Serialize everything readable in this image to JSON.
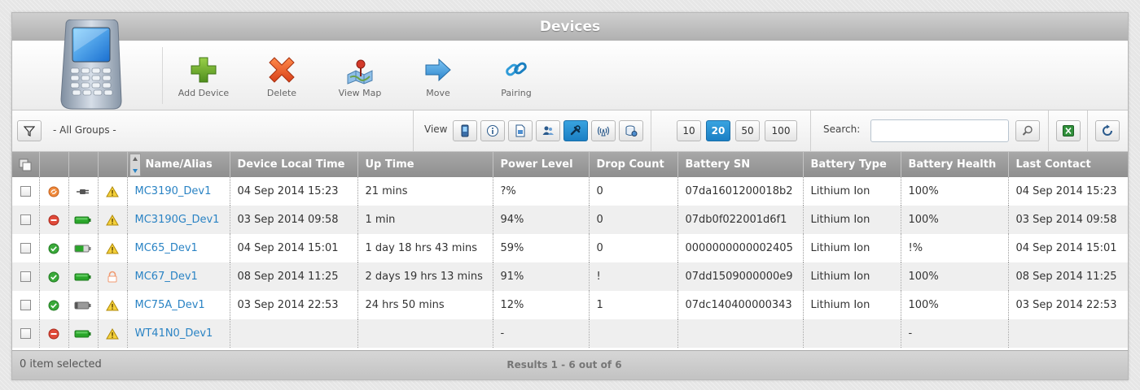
{
  "window": {
    "title": "Devices"
  },
  "toolbar": {
    "buttons": [
      {
        "label": "Add Device",
        "icon": "plus-icon"
      },
      {
        "label": "Delete",
        "icon": "x-icon"
      },
      {
        "label": "View Map",
        "icon": "map-icon"
      },
      {
        "label": "Move",
        "icon": "arrow-right-icon"
      },
      {
        "label": "Pairing",
        "icon": "link-icon"
      }
    ]
  },
  "filter": {
    "group_label": "- All Groups -",
    "view_label": "View",
    "page_sizes": [
      "10",
      "20",
      "50",
      "100"
    ],
    "active_page_size": "20",
    "search_label": "Search:",
    "search_value": ""
  },
  "grid": {
    "columns": [
      "Name/Alias",
      "Device Local Time",
      "Up Time",
      "Power Level",
      "Drop Count",
      "Battery SN",
      "Battery Type",
      "Battery Health",
      "Last Contact"
    ],
    "rows": [
      {
        "status": "sync",
        "power": "plug",
        "alert": "warning",
        "name": "MC3190_Dev1",
        "local_time": "04 Sep 2014 15:23",
        "uptime": "21 mins",
        "power_level": "?%",
        "drop_count": "0",
        "battery_sn": "07da1601200018b2",
        "battery_type": "Lithium Ion",
        "battery_health": "100%",
        "last_contact": "04 Sep 2014 15:23"
      },
      {
        "status": "disconnected",
        "power": "battery-full",
        "alert": "warning",
        "name": "MC3190G_Dev1",
        "local_time": "03 Sep 2014 09:58",
        "uptime": "1 min",
        "power_level": "94%",
        "drop_count": "0",
        "battery_sn": "07db0f022001d6f1",
        "battery_type": "Lithium Ion",
        "battery_health": "100%",
        "last_contact": "03 Sep 2014 09:58"
      },
      {
        "status": "ok",
        "power": "battery-half",
        "alert": "warning",
        "name": "MC65_Dev1",
        "local_time": "04 Sep 2014 15:01",
        "uptime": "1 day 18 hrs 43 mins",
        "power_level": "59%",
        "drop_count": "0",
        "battery_sn": "0000000000002405",
        "battery_type": "Lithium Ion",
        "battery_health": "!%",
        "last_contact": "04 Sep 2014 15:01"
      },
      {
        "status": "ok",
        "power": "battery-full",
        "alert": "lock",
        "name": "MC67_Dev1",
        "local_time": "08 Sep 2014 11:25",
        "uptime": "2 days 19 hrs 13 mins",
        "power_level": "91%",
        "drop_count": "!",
        "battery_sn": "07dd1509000000e9",
        "battery_type": "Lithium Ion",
        "battery_health": "100%",
        "last_contact": "08 Sep 2014 11:25"
      },
      {
        "status": "ok",
        "power": "battery-low",
        "alert": "warning",
        "name": "MC75A_Dev1",
        "local_time": "03 Sep 2014 22:53",
        "uptime": "24 hrs 50 mins",
        "power_level": "12%",
        "drop_count": "1",
        "battery_sn": "07dc140400000343",
        "battery_type": "Lithium Ion",
        "battery_health": "100%",
        "last_contact": "03 Sep 2014 22:53"
      },
      {
        "status": "disconnected",
        "power": "battery-full",
        "alert": "warning",
        "name": "WT41N0_Dev1",
        "local_time": "",
        "uptime": "",
        "power_level": "-",
        "drop_count": "",
        "battery_sn": "",
        "battery_type": "",
        "battery_health": "-",
        "last_contact": ""
      }
    ]
  },
  "footer": {
    "selected_text": "0 item selected",
    "results_text": "Results 1 - 6 out of 6"
  },
  "colors": {
    "accent": "#1b7fc4",
    "link": "#2a83c4",
    "header": "#9a9a9a"
  }
}
